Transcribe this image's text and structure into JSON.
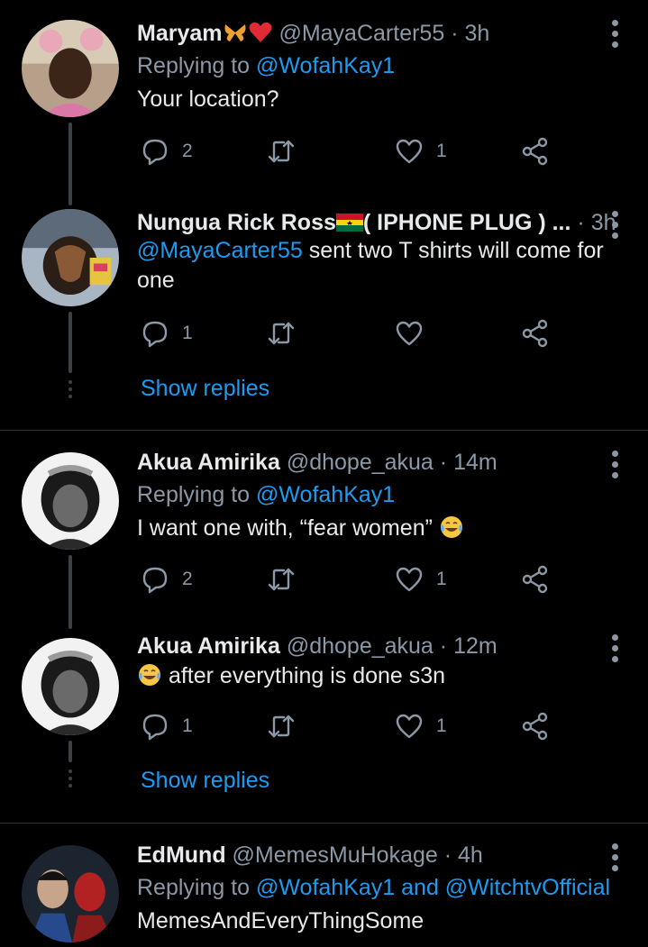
{
  "tweets": [
    {
      "name": "Maryam",
      "name_emojis": "🦋❤",
      "handle": "@MayaCarter55",
      "time": "3h",
      "replying_prefix": "Replying to ",
      "replying_to": "@WofahKay1",
      "text": "Your location?",
      "replies": "2",
      "retweets": "",
      "likes": "1"
    },
    {
      "name": "Nungua Rick Ross",
      "name_suffix": "( IPHONE PLUG ) ...",
      "handle": "",
      "time": "3h",
      "mention": "@MayaCarter55",
      "text": " sent two T shirts will come for one",
      "replies": "1",
      "retweets": "",
      "likes": ""
    },
    {
      "name": "Akua Amirika",
      "handle": "@dhope_akua",
      "time": "14m",
      "replying_prefix": "Replying to ",
      "replying_to": "@WofahKay1",
      "text": "I want one with, “fear women”",
      "replies": "2",
      "retweets": "",
      "likes": "1"
    },
    {
      "name": "Akua Amirika",
      "handle": "@dhope_akua",
      "time": "12m",
      "text": "after everything is done s3n",
      "replies": "1",
      "retweets": "",
      "likes": "1"
    },
    {
      "name": "EdMund",
      "handle": "@MemesMuHokage",
      "time": "4h",
      "replying_prefix": "Replying to ",
      "replying_to": "@WofahKay1 and @WitchtvOfficial",
      "text": "MemesAndEveryThingSome"
    }
  ],
  "show_replies_label": "Show replies",
  "separator": "·",
  "colors": {
    "background": "#000000",
    "link": "#1d9bf0",
    "muted": "#8b98a5",
    "text": "#e7e9ea"
  }
}
